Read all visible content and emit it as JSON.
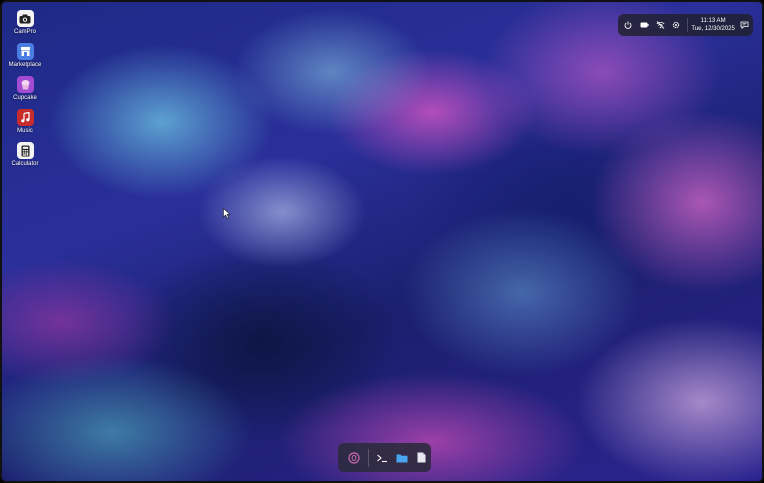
{
  "desktop": {
    "icons": [
      {
        "label": "CamPro",
        "icon": "camera-icon",
        "color": "#ffffff"
      },
      {
        "label": "Marketplace",
        "icon": "marketplace-icon",
        "color": "#4a7ee0"
      },
      {
        "label": "Cupcake",
        "icon": "cupcake-icon",
        "color": "#a24ad1"
      },
      {
        "label": "Music",
        "icon": "music-icon",
        "color": "#c62c2c"
      },
      {
        "label": "Calculator",
        "icon": "calculator-icon",
        "color": "#ffffff"
      }
    ]
  },
  "tray": {
    "icons": [
      "power-icon",
      "battery-icon",
      "wifi-off-icon",
      "settings-icon"
    ],
    "time": "11:13 AM",
    "date": "Tue, 12/30/2025",
    "notifications_icon": "notification-icon"
  },
  "taskbar": {
    "items": [
      "launcher-icon",
      "terminal-icon",
      "folder-icon",
      "document-icon"
    ],
    "accent": "#c86ab0"
  }
}
